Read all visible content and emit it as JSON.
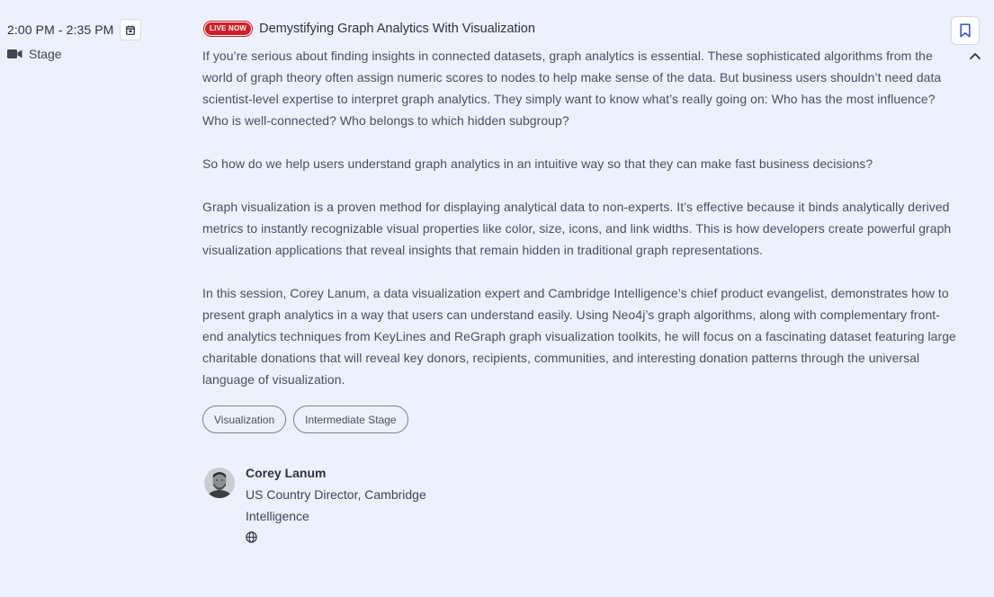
{
  "session": {
    "time": "2:00 PM - 2:35 PM",
    "location": "Stage",
    "badge": "LIVE NOW",
    "title": "Demystifying Graph Analytics With Visualization",
    "description": [
      "If you’re serious about finding insights in connected datasets, graph analytics is essential. These sophisticated algorithms from the world of graph theory often assign numeric scores to nodes to help make sense of the data. But business users shouldn’t need data scientist-level expertise to interpret graph analytics. They simply want to know what’s really going on: Who has the most influence? Who is well-connected? Who belongs to which hidden subgroup?",
      "So how do we help users understand graph analytics in an intuitive way so that they can make fast business decisions?",
      "Graph visualization is a proven method for displaying analytical data to non-experts. It’s effective because it binds analytically derived metrics to instantly recognizable visual properties like color, size, icons, and link widths. This is how developers create powerful graph visualization applications that reveal insights that remain hidden in traditional graph representations.",
      "In this session, Corey Lanum, a data visualization expert and Cambridge Intelligence’s chief product evangelist, demonstrates how to present graph analytics in a way that users can understand easily. Using Neo4j’s graph algorithms, along with complementary front-end analytics techniques from KeyLines and ReGraph graph visualization toolkits, he will focus on a fascinating dataset featuring large charitable donations that will reveal key donors, recipients, communities, and interesting donation patterns through the universal language of visualization."
    ],
    "tags": [
      "Visualization",
      "Intermediate Stage"
    ],
    "speaker": {
      "name": "Corey Lanum",
      "role": "US Country Director, Cambridge Intelligence"
    }
  },
  "icons": {
    "calendar": "calendar-icon",
    "video": "video-camera-icon",
    "bookmark": "bookmark-icon",
    "collapse": "chevron-up-icon",
    "website": "globe-icon"
  },
  "colors": {
    "background": "#edf1fd",
    "live_badge": "#d31f26",
    "bookmark": "#2f5bd3",
    "text": "#2d3142"
  }
}
